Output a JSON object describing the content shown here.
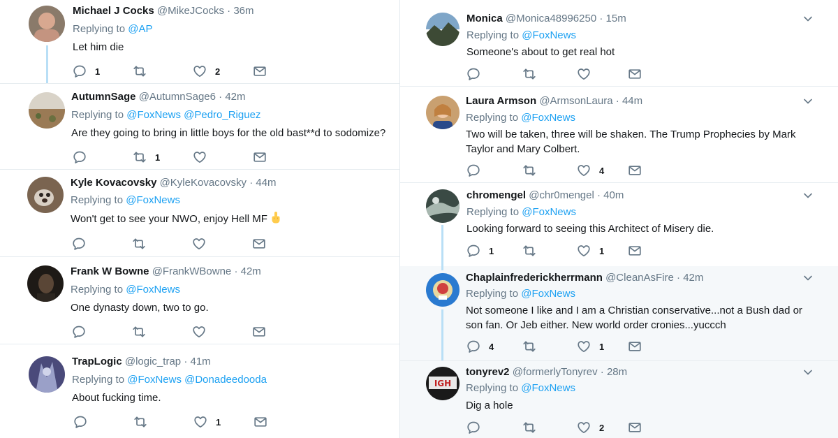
{
  "left_column": {
    "tweets": [
      {
        "name": "Michael J Cocks",
        "handle": "@MikeJCocks",
        "dot": "·",
        "time": "36m",
        "replying_label": "Replying to",
        "replying_to": "@AP",
        "text": "Let him die",
        "replies": "1",
        "retweets": "",
        "likes": "2"
      },
      {
        "name": "AutumnSage",
        "handle": "@AutumnSage6",
        "dot": "·",
        "time": "42m",
        "replying_label": "Replying to",
        "replying_to": "@FoxNews @Pedro_Riguez",
        "text": "Are they going to bring in little boys for the old bast**d to sodomize?",
        "replies": "",
        "retweets": "1",
        "likes": ""
      },
      {
        "name": "Kyle Kovacovsky",
        "handle": "@KyleKovacovsky",
        "dot": "·",
        "time": "44m",
        "replying_label": "Replying to",
        "replying_to": "@FoxNews",
        "text": "Won't get to see your NWO, enjoy Hell MF",
        "replies": "",
        "retweets": "",
        "likes": ""
      },
      {
        "name": "Frank W Bowne",
        "handle": "@FrankWBowne",
        "dot": "·",
        "time": "42m",
        "replying_label": "Replying to",
        "replying_to": "@FoxNews",
        "text": "One dynasty down, two to go.",
        "replies": "",
        "retweets": "",
        "likes": ""
      },
      {
        "name": "TrapLogic",
        "handle": "@logic_trap",
        "dot": "·",
        "time": "41m",
        "replying_label": "Replying to",
        "replying_to": "@FoxNews @Donadeedooda",
        "text": "About fucking time.",
        "replies": "",
        "retweets": "",
        "likes": "1"
      }
    ]
  },
  "right_column": {
    "tweets": [
      {
        "name": "Monica",
        "handle": "@Monica48996250",
        "dot": "·",
        "time": "15m",
        "replying_label": "Replying to",
        "replying_to": "@FoxNews",
        "text": "Someone's about to get real hot",
        "replies": "",
        "retweets": "",
        "likes": ""
      },
      {
        "name": "Laura Armson",
        "handle": "@ArmsonLaura",
        "dot": "·",
        "time": "44m",
        "replying_label": "Replying to",
        "replying_to": "@FoxNews",
        "text": "Two will be taken, three will be shaken. The Trump Prophecies by Mark Taylor and Mary Colbert.",
        "replies": "",
        "retweets": "",
        "likes": "4"
      },
      {
        "name": "chromengel",
        "handle": "@chr0mengel",
        "dot": "·",
        "time": "40m",
        "replying_label": "Replying to",
        "replying_to": "@FoxNews",
        "text": "Looking forward to seeing this Architect of Misery die.",
        "replies": "1",
        "retweets": "",
        "likes": "1"
      },
      {
        "name": "Chaplainfrederickherrmann",
        "handle": "@CleanAsFire",
        "dot": "·",
        "time": "42m",
        "replying_label": "Replying to",
        "replying_to": "@FoxNews",
        "text": "Not someone I like and I am a Christian conservative...not a Bush dad or son fan. Or Jeb either. New world order cronies...yuccch",
        "replies": "4",
        "retweets": "",
        "likes": "1"
      },
      {
        "name": "tonyrev2",
        "handle": "@formerlyTonyrev",
        "dot": "·",
        "time": "28m",
        "replying_label": "Replying to",
        "replying_to": "@FoxNews",
        "text": "Dig a hole",
        "replies": "",
        "retweets": "",
        "likes": "2"
      }
    ]
  },
  "icons": {
    "reply": "reply-icon",
    "retweet": "retweet-icon",
    "like": "heart-icon",
    "dm": "envelope-icon",
    "caret": "chevron-down-icon",
    "emoji": "middle-finger-emoji"
  },
  "colors": {
    "link": "#1da1f2",
    "secondary_text": "#657786",
    "thread_line": "#b9dff6",
    "divider": "#e6ecf0",
    "highlight_background": "#f5f8fa"
  }
}
